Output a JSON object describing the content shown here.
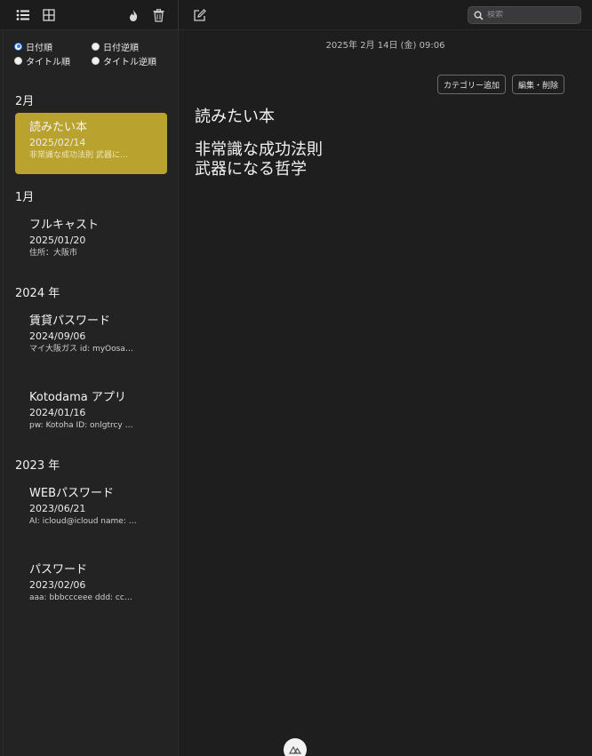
{
  "toolbar": {
    "icons": [
      "list-view-icon",
      "grid-view-icon",
      "flame-icon",
      "trash-icon",
      "compose-icon",
      "search-icon"
    ],
    "search_placeholder": "検索"
  },
  "sort_options": [
    {
      "label": "日付順",
      "checked": true
    },
    {
      "label": "日付逆順",
      "checked": false
    },
    {
      "label": "タイトル順",
      "checked": false
    },
    {
      "label": "タイトル逆順",
      "checked": false
    }
  ],
  "groups": [
    {
      "header": "2月",
      "notes": [
        {
          "title": "読みたい本",
          "date": "2025/02/14",
          "preview": "非常識な成功法則 武器に…",
          "selected": true
        }
      ]
    },
    {
      "header": "1月",
      "notes": [
        {
          "title": "フルキャスト",
          "date": "2025/01/20",
          "preview": "住所：大阪市"
        }
      ]
    },
    {
      "header": "2024 年",
      "notes": [
        {
          "title": "賃貸パスワード",
          "date": "2024/09/06",
          "preview": "マイ大阪ガス id: myOosa…"
        },
        {
          "title": "Kotodama アプリ",
          "date": "2024/01/16",
          "preview": "pw: Kotoha ID: onlgtrcy …"
        }
      ]
    },
    {
      "header": "2023 年",
      "notes": [
        {
          "title": "WEBパスワード",
          "date": "2023/06/21",
          "preview": "AI: icloud@icloud name: …"
        },
        {
          "title": "パスワード",
          "date": "2023/02/06",
          "preview": "aaa: bbbccceee ddd: cc…"
        }
      ]
    }
  ],
  "main": {
    "datetime": "2025年 2月 14日 (金) 09:06",
    "add_category_label": "カテゴリー追加",
    "edit_delete_label": "編集・削除",
    "note_title": "読みたい本",
    "note_lines": [
      "非常識な成功法則",
      "武器になる哲学"
    ]
  },
  "colors": {
    "selected_note": "#b9a22e",
    "radio_accent": "#2f7bf6",
    "background": "#1e1e1e"
  }
}
